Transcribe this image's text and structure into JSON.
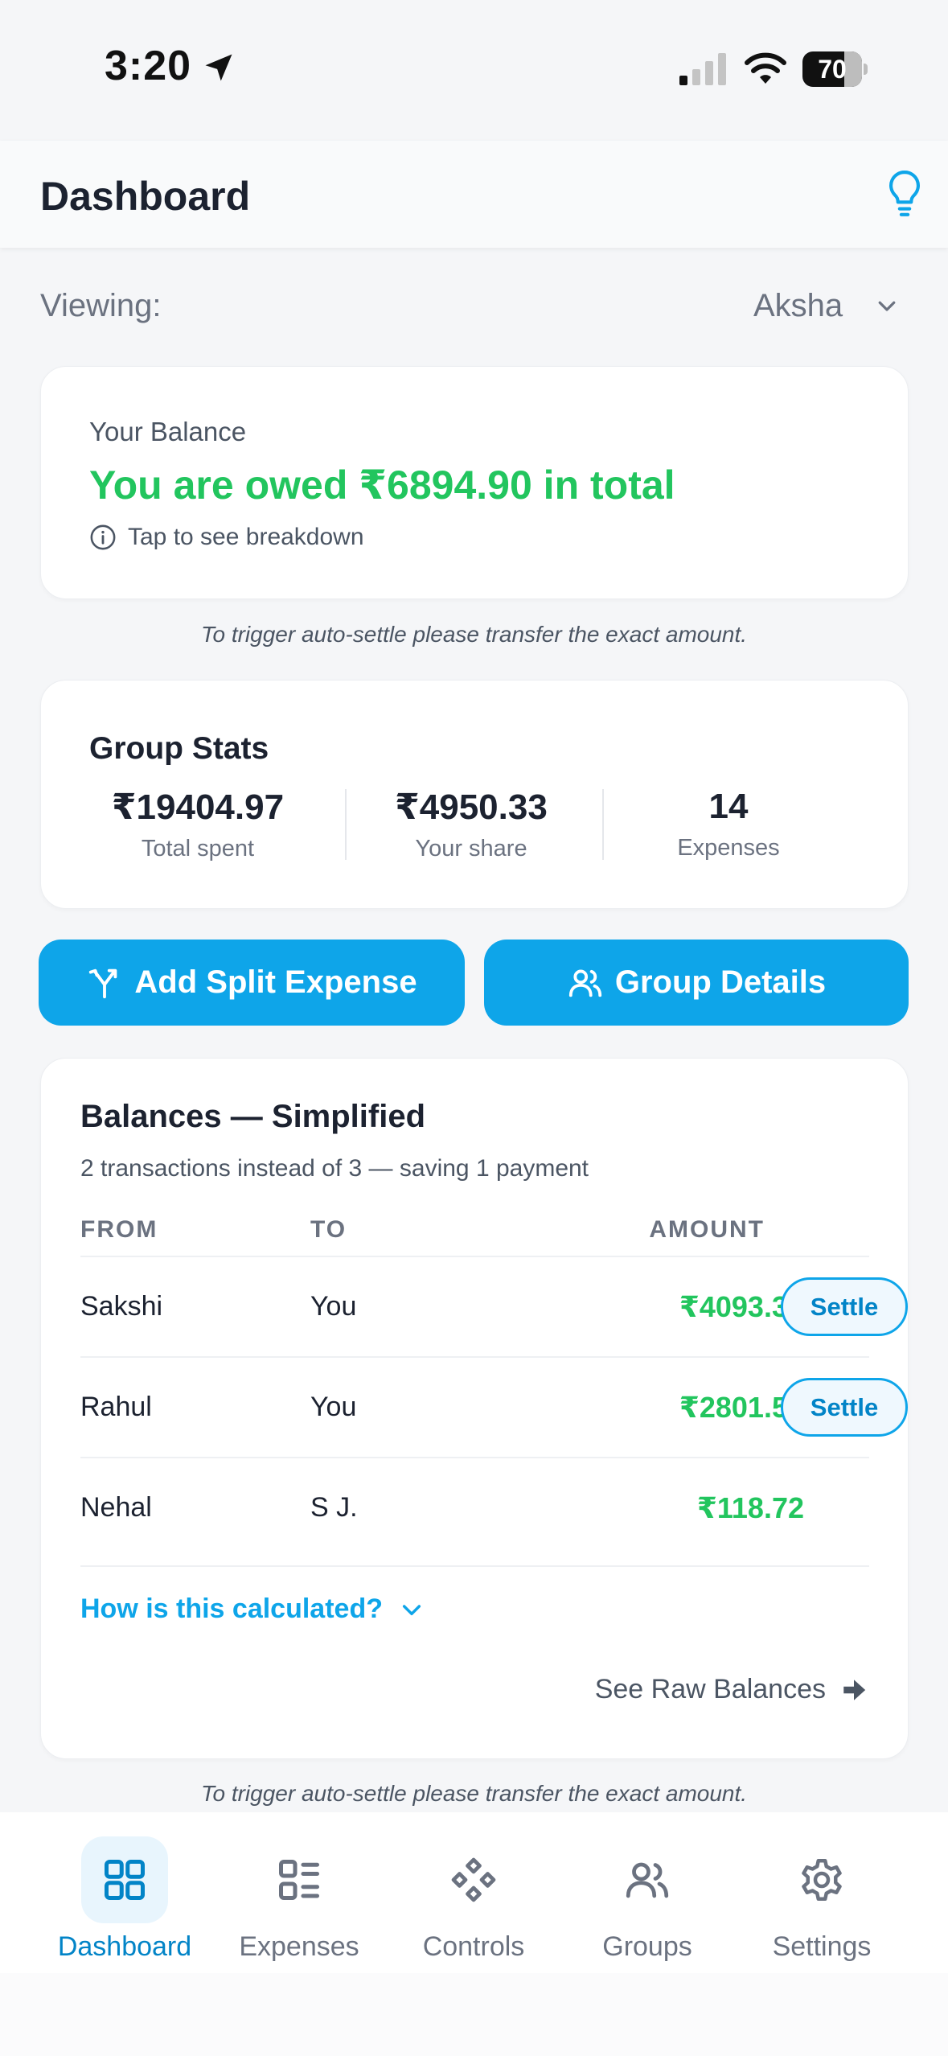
{
  "status_bar": {
    "time": "3:20",
    "battery": "70"
  },
  "header": {
    "title": "Dashboard"
  },
  "viewing": {
    "label": "Viewing:",
    "value": "Aksha"
  },
  "balance": {
    "label": "Your Balance",
    "summary": "You are owed ₹6894.90 in total",
    "breakdown_hint": "Tap to see breakdown"
  },
  "note": "To trigger auto-settle please transfer the exact amount.",
  "group_stats": {
    "title": "Group Stats",
    "items": [
      {
        "value": "₹19404.97",
        "label": "Total spent"
      },
      {
        "value": "₹4950.33",
        "label": "Your share"
      },
      {
        "value": "14",
        "label": "Expenses"
      }
    ]
  },
  "actions": {
    "add_split": "Add Split Expense",
    "group_details": "Group Details"
  },
  "balances": {
    "title": "Balances — Simplified",
    "subtitle": "2 transactions instead of 3 — saving 1 payment",
    "columns": {
      "from": "FROM",
      "to": "TO",
      "amount": "AMOUNT"
    },
    "rows": [
      {
        "from": "Sakshi",
        "to": "You",
        "amount": "₹4093.32",
        "action": "Settle"
      },
      {
        "from": "Rahul",
        "to": "You",
        "amount": "₹2801.58",
        "action": "Settle"
      },
      {
        "from": "Nehal",
        "to": "S J.",
        "amount": "₹118.72"
      }
    ],
    "how_calculated": "How is this calculated?",
    "raw_link": "See Raw Balances"
  },
  "nav": {
    "items": [
      {
        "label": "Dashboard",
        "icon": "grid-icon",
        "active": true
      },
      {
        "label": "Expenses",
        "icon": "list-icon"
      },
      {
        "label": "Controls",
        "icon": "diamonds-icon"
      },
      {
        "label": "Groups",
        "icon": "users-icon"
      },
      {
        "label": "Settings",
        "icon": "gear-icon"
      }
    ]
  },
  "colors": {
    "accent": "#0ea5e9",
    "positive": "#22c55e",
    "text": "#1c2230",
    "muted": "#6b7280"
  }
}
